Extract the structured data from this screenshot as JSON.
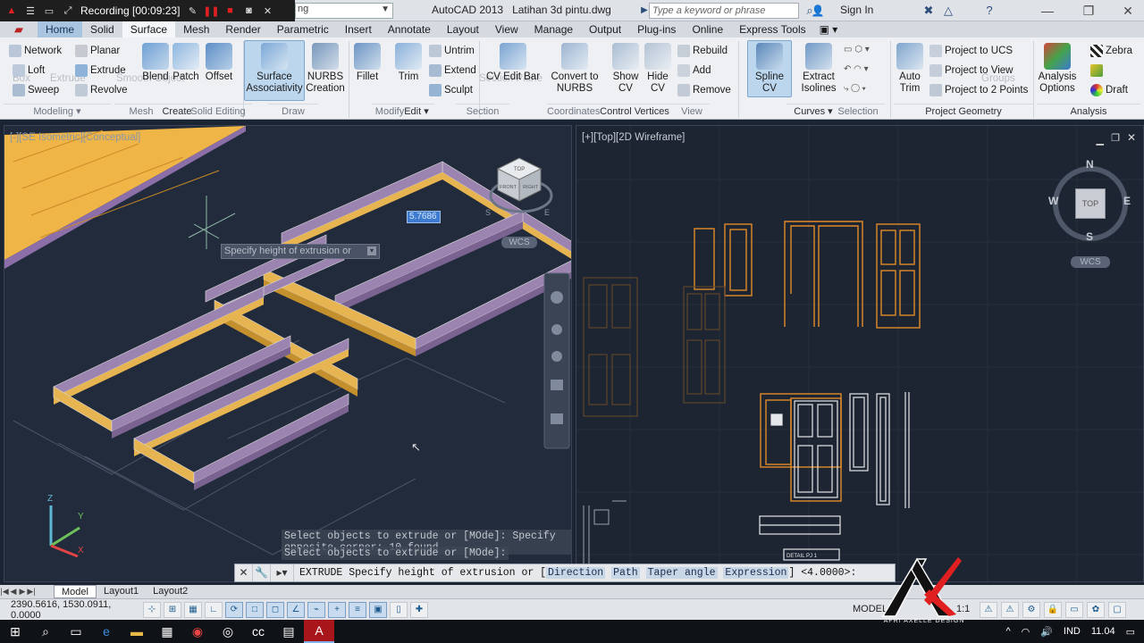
{
  "title_bar": {
    "recording_label": "Recording [00:09:23]",
    "workspace_value": "ng",
    "app_title": "AutoCAD 2013",
    "file_name": "Latihan 3d pintu.dwg",
    "search_placeholder": "Type a keyword or phrase",
    "sign_in": "Sign In"
  },
  "tabs": [
    "Home",
    "Solid",
    "Surface",
    "Mesh",
    "Render",
    "Parametric",
    "Insert",
    "Annotate",
    "Layout",
    "View",
    "Manage",
    "Output",
    "Plug-ins",
    "Online",
    "Express Tools"
  ],
  "active_tab": "Surface",
  "ribbon": {
    "create": {
      "network": "Network",
      "planar": "Planar",
      "loft": "Loft",
      "extrude": "Extrude",
      "sweep": "Sweep",
      "revolve": "Revolve",
      "blend": "Blend",
      "patch": "Patch",
      "offset": "Offset",
      "surface_associativity": "Surface\nAssociativity",
      "nurbs_creation": "NURBS\nCreation",
      "panel": "Create"
    },
    "edit": {
      "fillet": "Fillet",
      "trim": "Trim",
      "untrim": "Untrim",
      "extend": "Extend",
      "sculpt": "Sculpt",
      "panel": "Edit"
    },
    "control_vertices": {
      "cv_edit_bar": "CV Edit Bar",
      "convert_to_nurbs": "Convert to\nNURBS",
      "show_cv": "Show\nCV",
      "hide_cv": "Hide\nCV",
      "rebuild": "Rebuild",
      "add": "Add",
      "remove": "Remove",
      "panel": "Control Vertices"
    },
    "curves": {
      "spline_cv": "Spline CV",
      "extract_isolines": "Extract\nIsolines",
      "panel": "Curves"
    },
    "project_geometry": {
      "auto_trim": "Auto\nTrim",
      "project_to_ucs": "Project to UCS",
      "project_to_view": "Project to View",
      "project_to_2_points": "Project to 2 Points",
      "panel": "Project Geometry"
    },
    "analysis": {
      "analysis_options": "Analysis\nOptions",
      "zebra": "Zebra",
      "draft": "Draft",
      "panel": "Analysis"
    },
    "ghost_labels": {
      "modeling": "Modeling",
      "mesh": "Mesh",
      "solid_editing": "Solid Editing",
      "draw": "Draw",
      "modify": "Modify",
      "section": "Section",
      "coordinates": "Coordinates",
      "view": "View",
      "selection": "Selection",
      "box": "Box",
      "extrude_g": "Extrude",
      "smooth_object": "Smooth Object",
      "section_plane": "Section Plane",
      "groups": "Groups"
    }
  },
  "viewports": {
    "left_label": "[-][SE Isometric][Conceptual]",
    "right_label": "[+][Top][2D Wireframe]",
    "dynamic_input_value": "5.7686",
    "tooltip": "Specify height of extrusion or",
    "wcs": "WCS",
    "compass": {
      "n": "N",
      "s": "S",
      "e": "E",
      "w": "W",
      "top": "TOP"
    },
    "viewcube_faces": {
      "top": "TOP",
      "front": "FRONT",
      "right": "RIGHT"
    },
    "axis": {
      "x": "X",
      "y": "Y",
      "z": "Z"
    },
    "detail_label": "DETAIL PJ 1"
  },
  "command": {
    "history_1": "Select objects to extrude or [MOde]: Specify opposite corner: 10 found",
    "history_2": "Select objects to extrude or [MOde]:",
    "prompt_prefix": "EXTRUDE Specify height of extrusion or [",
    "opt_direction": "Direction",
    "opt_path": "Path",
    "opt_taper": "Taper angle",
    "opt_expression": "Expression",
    "prompt_suffix": "] <4.0000>:"
  },
  "layout_tabs": [
    "Model",
    "Layout1",
    "Layout2"
  ],
  "status": {
    "coordinates": "2390.5616, 1530.0911, 0.0000",
    "model": "MODEL",
    "scale": "1:1"
  },
  "taskbar": {
    "language": "IND",
    "time": "11.04"
  },
  "watermark": "AFRI AXELLE DESIGN",
  "colors": {
    "ribbon_bg": "#eef0f3",
    "active_tab": "#a8c4de",
    "viewport_bg": "#222b3b",
    "extrusion_top": "#9c84b0",
    "extrusion_side": "#e6b450",
    "door_lines": "#e08a2a"
  }
}
